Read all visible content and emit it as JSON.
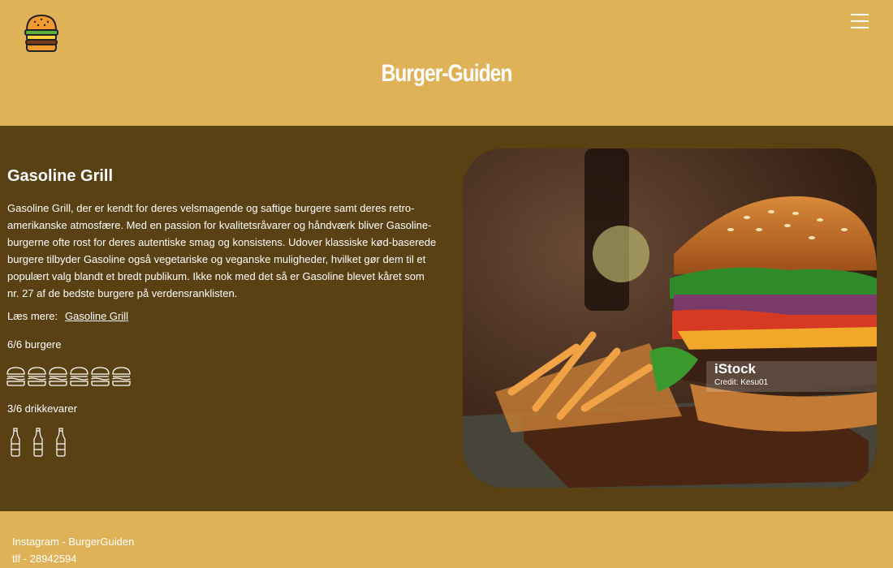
{
  "header": {
    "logo_icon": "burger-icon",
    "menu_icon": "hamburger-menu-icon",
    "title": "Burger-Guiden"
  },
  "restaurant": {
    "name": "Gasoline Grill",
    "description": "Gasoline Grill, der er kendt for deres velsmagende og saftige burgere samt deres retro-amerikanske atmosfære. Med en passion for kvalitetsråvarer og håndværk bliver Gasoline-burgerne ofte rost for deres autentiske smag og konsistens. Udover klassiske kød-baserede burgere tilbyder Gasoline også vegetariske og veganske muligheder, hvilket gør dem til et populært valg blandt et bredt publikum. Ikke nok med det så er Gasoline blevet kåret som nr. 27 af de bedste burgere på verdensranklisten.",
    "read_more_label": "Læs mere:",
    "read_more_link": "Gasoline Grill",
    "burger_rating_text": "6/6 burgere",
    "burger_rating": 6,
    "burger_rating_max": 6,
    "drink_rating_text": "3/6 drikkevarer",
    "drink_rating": 3,
    "drink_rating_max": 6,
    "photo": {
      "subject": "burger with fries on wooden board",
      "watermark_brand": "iStock",
      "watermark_credit": "Credit: Kesu01"
    }
  },
  "footer": {
    "instagram": "Instagram - BurgerGuiden",
    "phone": "tlf - 28942594"
  },
  "colors": {
    "header_bg": "#dfb257",
    "main_bg": "#5a4114",
    "text": "#ffffff"
  }
}
